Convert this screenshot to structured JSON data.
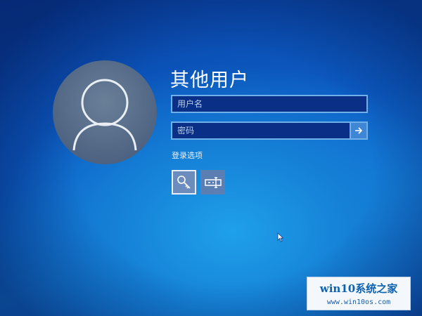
{
  "login": {
    "title": "其他用户",
    "username_placeholder": "用户名",
    "password_placeholder": "密码",
    "options_label": "登录选项",
    "options": [
      {
        "icon": "key-icon",
        "selected": true
      },
      {
        "icon": "pin-pad-icon",
        "selected": false
      }
    ]
  },
  "watermark": {
    "line1": "win10系统之家",
    "line2": "www.win10os.com"
  },
  "colors": {
    "background": "#0c5cc4",
    "field_border": "#6fb0ea",
    "field_fill": "#0a2f86",
    "text": "#ffffff"
  }
}
